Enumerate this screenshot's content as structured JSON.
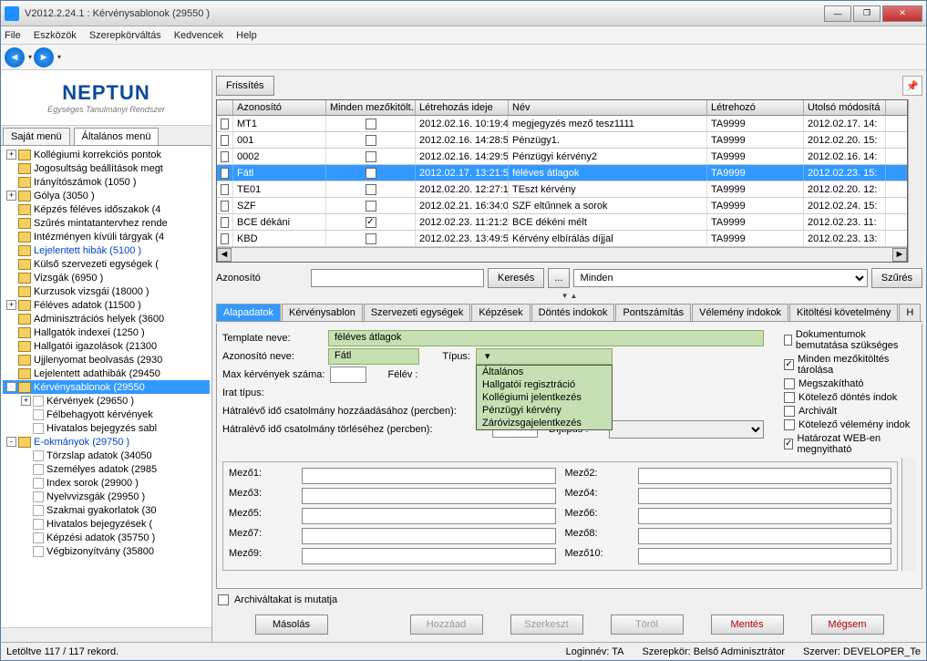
{
  "window": {
    "title": "V2012.2.24.1 : Kérvénysablonok (29550  )"
  },
  "menus": {
    "file": "File",
    "tools": "Eszközök",
    "roleswitch": "Szerepkörváltás",
    "fav": "Kedvencek",
    "help": "Help"
  },
  "toolbar": {
    "refresh": "Frissítés"
  },
  "logo": {
    "name": "NEPTUN",
    "sub": "Egységes Tanulmányi Rendszer"
  },
  "lefttabs": {
    "own": "Saját menü",
    "general": "Általános menü"
  },
  "tree": [
    {
      "ind": 0,
      "exp": "+",
      "label": "Kollégiumi korrekciós pontok"
    },
    {
      "ind": 0,
      "exp": "",
      "label": "Jogosultság beállítások megt"
    },
    {
      "ind": 0,
      "exp": "",
      "label": "Irányítószámok (1050  )"
    },
    {
      "ind": 0,
      "exp": "+",
      "label": "Gólya (3050  )"
    },
    {
      "ind": 0,
      "exp": "",
      "label": "Képzés féléves időszakok (4"
    },
    {
      "ind": 0,
      "exp": "",
      "label": "Szűrés mintatantervhez rende"
    },
    {
      "ind": 0,
      "exp": "",
      "label": "Intézményen kívüli tárgyak (4"
    },
    {
      "ind": 0,
      "exp": "",
      "label": "Lejelentett hibák (5100  )",
      "cls": "blue"
    },
    {
      "ind": 0,
      "exp": "",
      "label": "Külső szervezeti egységek ("
    },
    {
      "ind": 0,
      "exp": "",
      "label": "Vizsgák (6950  )"
    },
    {
      "ind": 0,
      "exp": "",
      "label": "Kurzusok vizsgái (18000  )"
    },
    {
      "ind": 0,
      "exp": "+",
      "label": "Féléves adatok (11500  )"
    },
    {
      "ind": 0,
      "exp": "",
      "label": "Adminisztrációs helyek (3600"
    },
    {
      "ind": 0,
      "exp": "",
      "label": "Hallgatók indexei (1250  )"
    },
    {
      "ind": 0,
      "exp": "",
      "label": "Hallgatói igazolások (21300"
    },
    {
      "ind": 0,
      "exp": "",
      "label": "Ujjlenyomat beolvasás (2930"
    },
    {
      "ind": 0,
      "exp": "",
      "label": "Lejelentett adathibák (29450"
    },
    {
      "ind": 0,
      "exp": "-",
      "label": "Kérvénysablonok (29550",
      "sel": true
    },
    {
      "ind": 1,
      "exp": "+",
      "label": "Kérvények (29650  )",
      "doc": true
    },
    {
      "ind": 1,
      "exp": "",
      "label": "Félbehagyott kérvények",
      "doc": true
    },
    {
      "ind": 1,
      "exp": "",
      "label": "Hivatalos bejegyzés sabl",
      "doc": true
    },
    {
      "ind": 0,
      "exp": "-",
      "label": "E-okmányok (29750  )",
      "cls": "blue"
    },
    {
      "ind": 1,
      "exp": "",
      "label": "Törzslap adatok (34050",
      "doc": true
    },
    {
      "ind": 1,
      "exp": "",
      "label": "Személyes adatok (2985",
      "doc": true
    },
    {
      "ind": 1,
      "exp": "",
      "label": "Index sorok (29900  )",
      "doc": true
    },
    {
      "ind": 1,
      "exp": "",
      "label": "Nyelvvizsgák (29950  )",
      "doc": true
    },
    {
      "ind": 1,
      "exp": "",
      "label": "Szakmai gyakorlatok (30",
      "doc": true
    },
    {
      "ind": 1,
      "exp": "",
      "label": "Hivatalos bejegyzések (",
      "doc": true
    },
    {
      "ind": 1,
      "exp": "",
      "label": "Képzési adatok (35750 )",
      "doc": true
    },
    {
      "ind": 1,
      "exp": "",
      "label": "Végbizonyítvány (35800",
      "doc": true
    }
  ],
  "grid": {
    "headers": {
      "id": "Azonosító",
      "all": "Minden mezőkitölt...",
      "created": "Létrehozás ideje",
      "name": "Név",
      "creator": "Létrehozó",
      "lastmod": "Utolsó módosítá"
    },
    "rows": [
      {
        "id": "MT1",
        "all": false,
        "created": "2012.02.16. 10:19:4",
        "name": "megjegyzés mező tesz1111",
        "creator": "TA9999",
        "lastmod": "2012.02.17. 14:"
      },
      {
        "id": "001",
        "all": false,
        "created": "2012.02.16. 14:28:5",
        "name": "Pénzügy1.",
        "creator": "TA9999",
        "lastmod": "2012.02.20. 15:"
      },
      {
        "id": "0002",
        "all": false,
        "created": "2012.02.16. 14:29:5",
        "name": "Pénzügyi kérvény2",
        "creator": "TA9999",
        "lastmod": "2012.02.16. 14:"
      },
      {
        "id": "Fátl",
        "all": true,
        "created": "2012.02.17. 13:21:5",
        "name": "féléves átlagok",
        "creator": "TA9999",
        "lastmod": "2012.02.23. 15:",
        "sel": true
      },
      {
        "id": "TE01",
        "all": false,
        "created": "2012.02.20. 12:27:1",
        "name": "TEszt kérvény",
        "creator": "TA9999",
        "lastmod": "2012.02.20. 12:"
      },
      {
        "id": "SZF",
        "all": false,
        "created": "2012.02.21. 16:34:0",
        "name": "SZF eltűnnek a sorok",
        "creator": "TA9999",
        "lastmod": "2012.02.24. 15:"
      },
      {
        "id": "BCE dékáni",
        "all": true,
        "created": "2012.02.23. 11:21:2",
        "name": "BCE dékéni mélt",
        "creator": "TA9999",
        "lastmod": "2012.02.23. 11:"
      },
      {
        "id": "KBD",
        "all": false,
        "created": "2012.02.23. 13:49:5",
        "name": "Kérvény elbírálás díjjal",
        "creator": "TA9999",
        "lastmod": "2012.02.23. 13:"
      }
    ]
  },
  "search": {
    "label": "Azonosító",
    "btn": "Keresés",
    "dots": "...",
    "all": "Minden",
    "filter": "Szűrés"
  },
  "dtabs": [
    "Alapadatok",
    "Kérvénysablon",
    "Szervezeti egységek",
    "Képzések",
    "Döntés indokok",
    "Pontszámítás",
    "Vélemény indokok",
    "Kitöltési követelmény",
    "H"
  ],
  "form": {
    "templatename_l": "Template neve:",
    "templatename": "féléves átlagok",
    "idname_l": "Azonosító neve:",
    "idname": "Fátl",
    "type_l": "Típus:",
    "max_l": "Max kérvények száma:",
    "term_l": "Félév :",
    "doctype_l": "Irat típus:",
    "remain_add": "Hátralévő idő csatolmány hozzáadásához (percben):",
    "remain_del": "Hátralévő idő csatolmány törléséhez (percben):",
    "feetype_l": "Díjtípus :",
    "typelist": [
      "Általános",
      "Hallgatói regisztráció",
      "Kollégiumi jelentkezés",
      "Pénzügyi kérvény",
      "Záróvizsgajelentkezés"
    ]
  },
  "checks": {
    "docs": "Dokumentumok bemutatása szükséges",
    "allstore": "Minden mezőkitöltés tárolása",
    "interrupt": "Megszakítható",
    "decision": "Kötelező döntés indok",
    "archived": "Archivált",
    "opinion": "Kötelező vélemény indok",
    "web": "Határozat WEB-en megnyitható"
  },
  "checks_state": {
    "allstore": true,
    "web": true
  },
  "fields": {
    "m1": "Mező1:",
    "m2": "Mező2:",
    "m3": "Mező3:",
    "m4": "Mező4:",
    "m5": "Mező5:",
    "m6": "Mező6:",
    "m7": "Mező7:",
    "m8": "Mező8:",
    "m9": "Mező9:",
    "m10": "Mező10:"
  },
  "archcb": "Archiváltakat is mutatja",
  "actions": {
    "copy": "Másolás",
    "add": "Hozzáad",
    "edit": "Szerkeszt",
    "del": "Töröl",
    "save": "Mentés",
    "cancel": "Mégsem"
  },
  "status": {
    "left": "Letöltve 117 / 117 rekord.",
    "login": "Loginnév: TA",
    "role": "Szerepkör: Belső Adminisztrátor",
    "server": "Szerver: DEVELOPER_Te"
  }
}
